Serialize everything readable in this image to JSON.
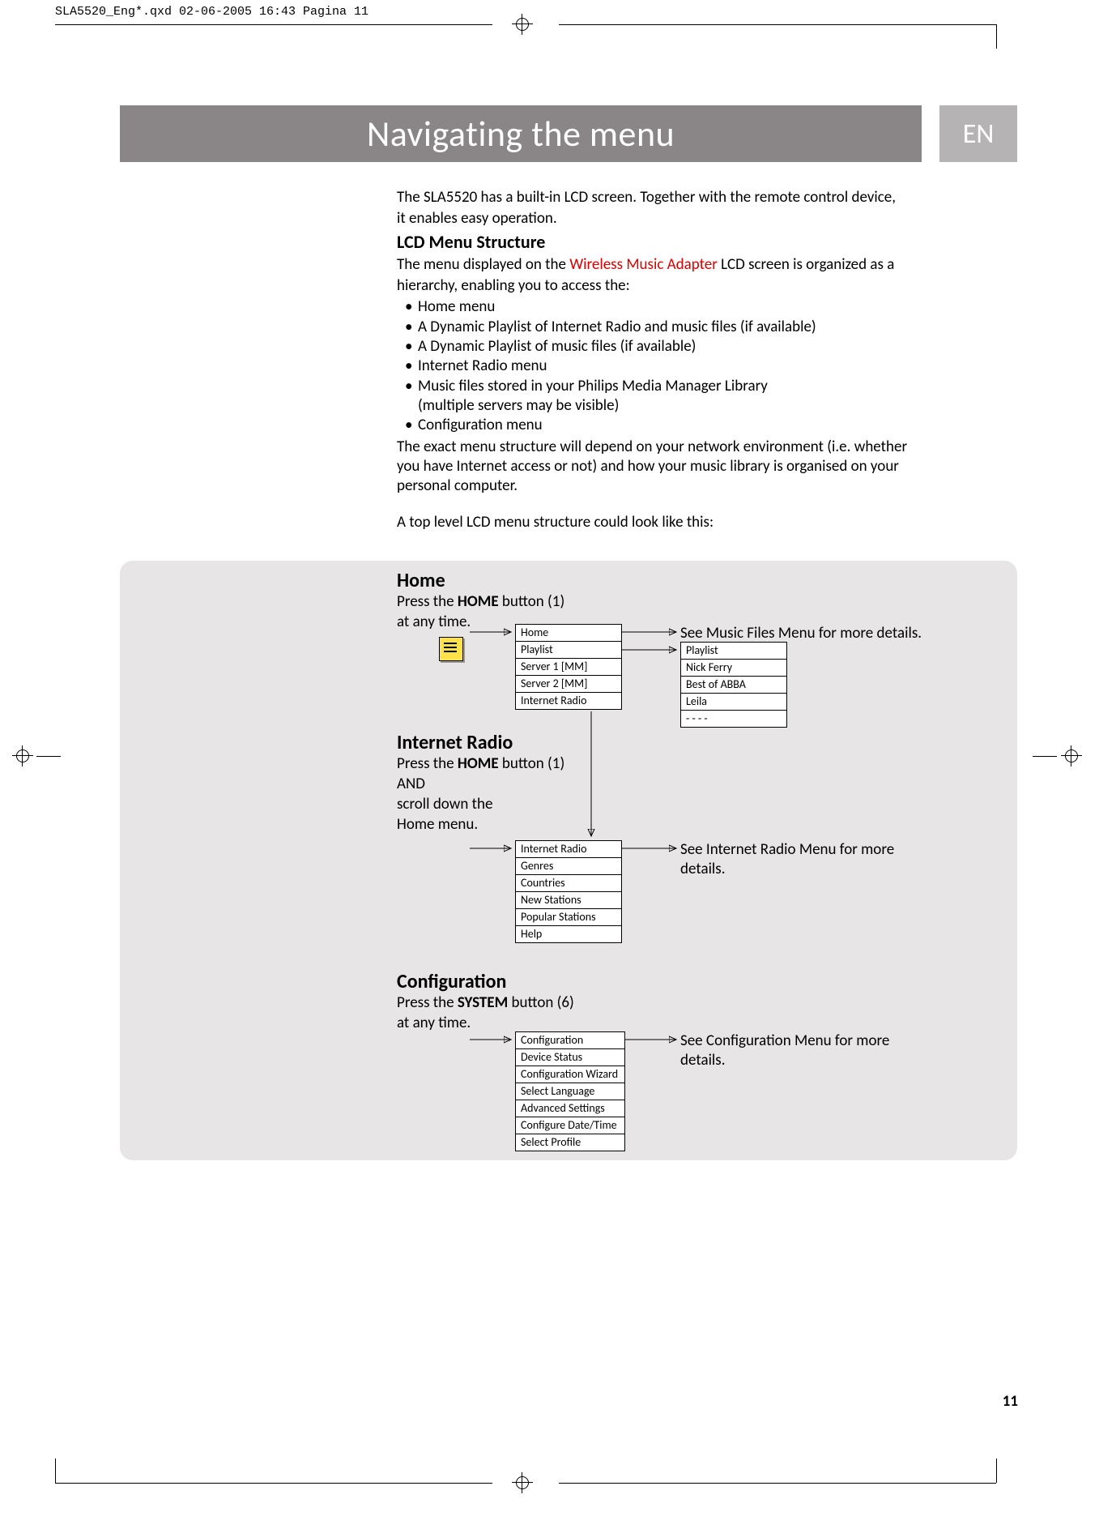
{
  "print_header": "SLA5520_Eng*.qxd  02-06-2005  16:43  Pagina 11",
  "title": "Navigating the menu",
  "lang": "EN",
  "intro_l1": "The SLA5520 has a built-in LCD screen. Together with the remote control device,",
  "intro_l2": " it enables easy operation.",
  "sec1_head": "LCD Menu Structure",
  "sec1_p1a": "The menu displayed on the ",
  "sec1_p1_red": "Wireless Music Adapter",
  "sec1_p1b": " LCD screen is organized as a",
  "sec1_p2": "hierarchy, enabling you to access the:",
  "bullets": [
    "Home menu",
    "A Dynamic Playlist of Internet Radio and music files (if available)",
    "A Dynamic Playlist of music files (if available)",
    "Internet Radio menu",
    "Music files stored in your Philips Media Manager Library",
    "(multiple servers may be visible)",
    "Configuration menu"
  ],
  "sec1_p3": "The exact menu structure will depend on your network environment (i.e. whether you have Internet access or not) and how your music library is organised on your personal computer.",
  "sec1_p4": "A top level LCD menu structure could look like this:",
  "home": {
    "head": "Home",
    "l1a": "Press the ",
    "l1b": "HOME",
    "l1c": " button (1)",
    "l2": "at any time."
  },
  "home_menu": [
    "Home",
    "Playlist",
    "Server 1 [MM]",
    "Server 2 [MM]",
    "Internet Radio"
  ],
  "playlist_menu": [
    "Playlist",
    "Nick Ferry",
    "Best of ABBA",
    "Leila",
    "- - - -"
  ],
  "home_ref": "See Music Files Menu for more details.",
  "radio": {
    "head": "Internet Radio",
    "l1a": "Press the ",
    "l1b": "HOME",
    "l1c": " button (1)",
    "l2": "AND",
    "l3": "scroll down the",
    "l4": "Home menu."
  },
  "radio_menu": [
    "Internet Radio",
    "Genres",
    "Countries",
    "New Stations",
    "Popular Stations",
    "Help"
  ],
  "radio_ref_l1": "See Internet Radio Menu for more",
  "radio_ref_l2": "details.",
  "config": {
    "head": "Configuration",
    "l1a": "Press the ",
    "l1b": "SYSTEM",
    "l1c": " button (6)",
    "l2": "at any time."
  },
  "config_menu": [
    "Configuration",
    "Device  Status",
    "Configuration Wizard",
    "Select Language",
    "Advanced Settings",
    "Configure Date/Time",
    "Select Profile"
  ],
  "config_ref_l1": "See Configuration Menu for more",
  "config_ref_l2": "details.",
  "page_num": "11"
}
